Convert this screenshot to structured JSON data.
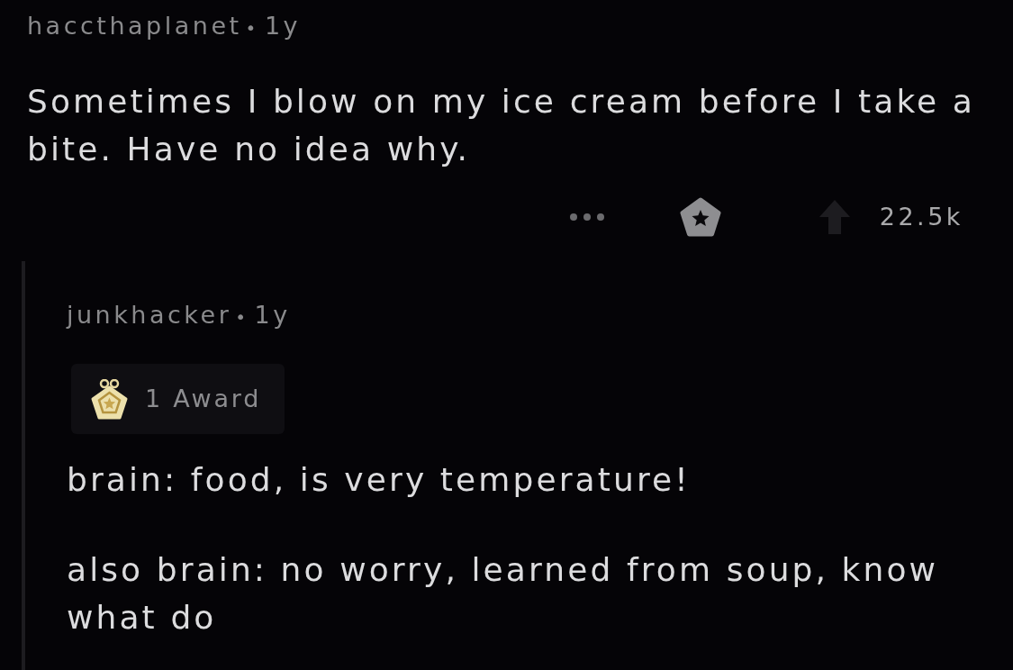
{
  "post": {
    "username": "haccthaplanet",
    "separator": "•",
    "age": "1y",
    "body": "Sometimes I blow on my ice cream before I take a bite. Have no idea why.",
    "score": "22.5k"
  },
  "reply": {
    "username": "junkhacker",
    "separator": "•",
    "age": "1y",
    "award": {
      "label": "1 Award"
    },
    "paragraphs": [
      "brain: food, is very temperature!",
      "also brain: no worry, learned from soup, know what do"
    ]
  }
}
